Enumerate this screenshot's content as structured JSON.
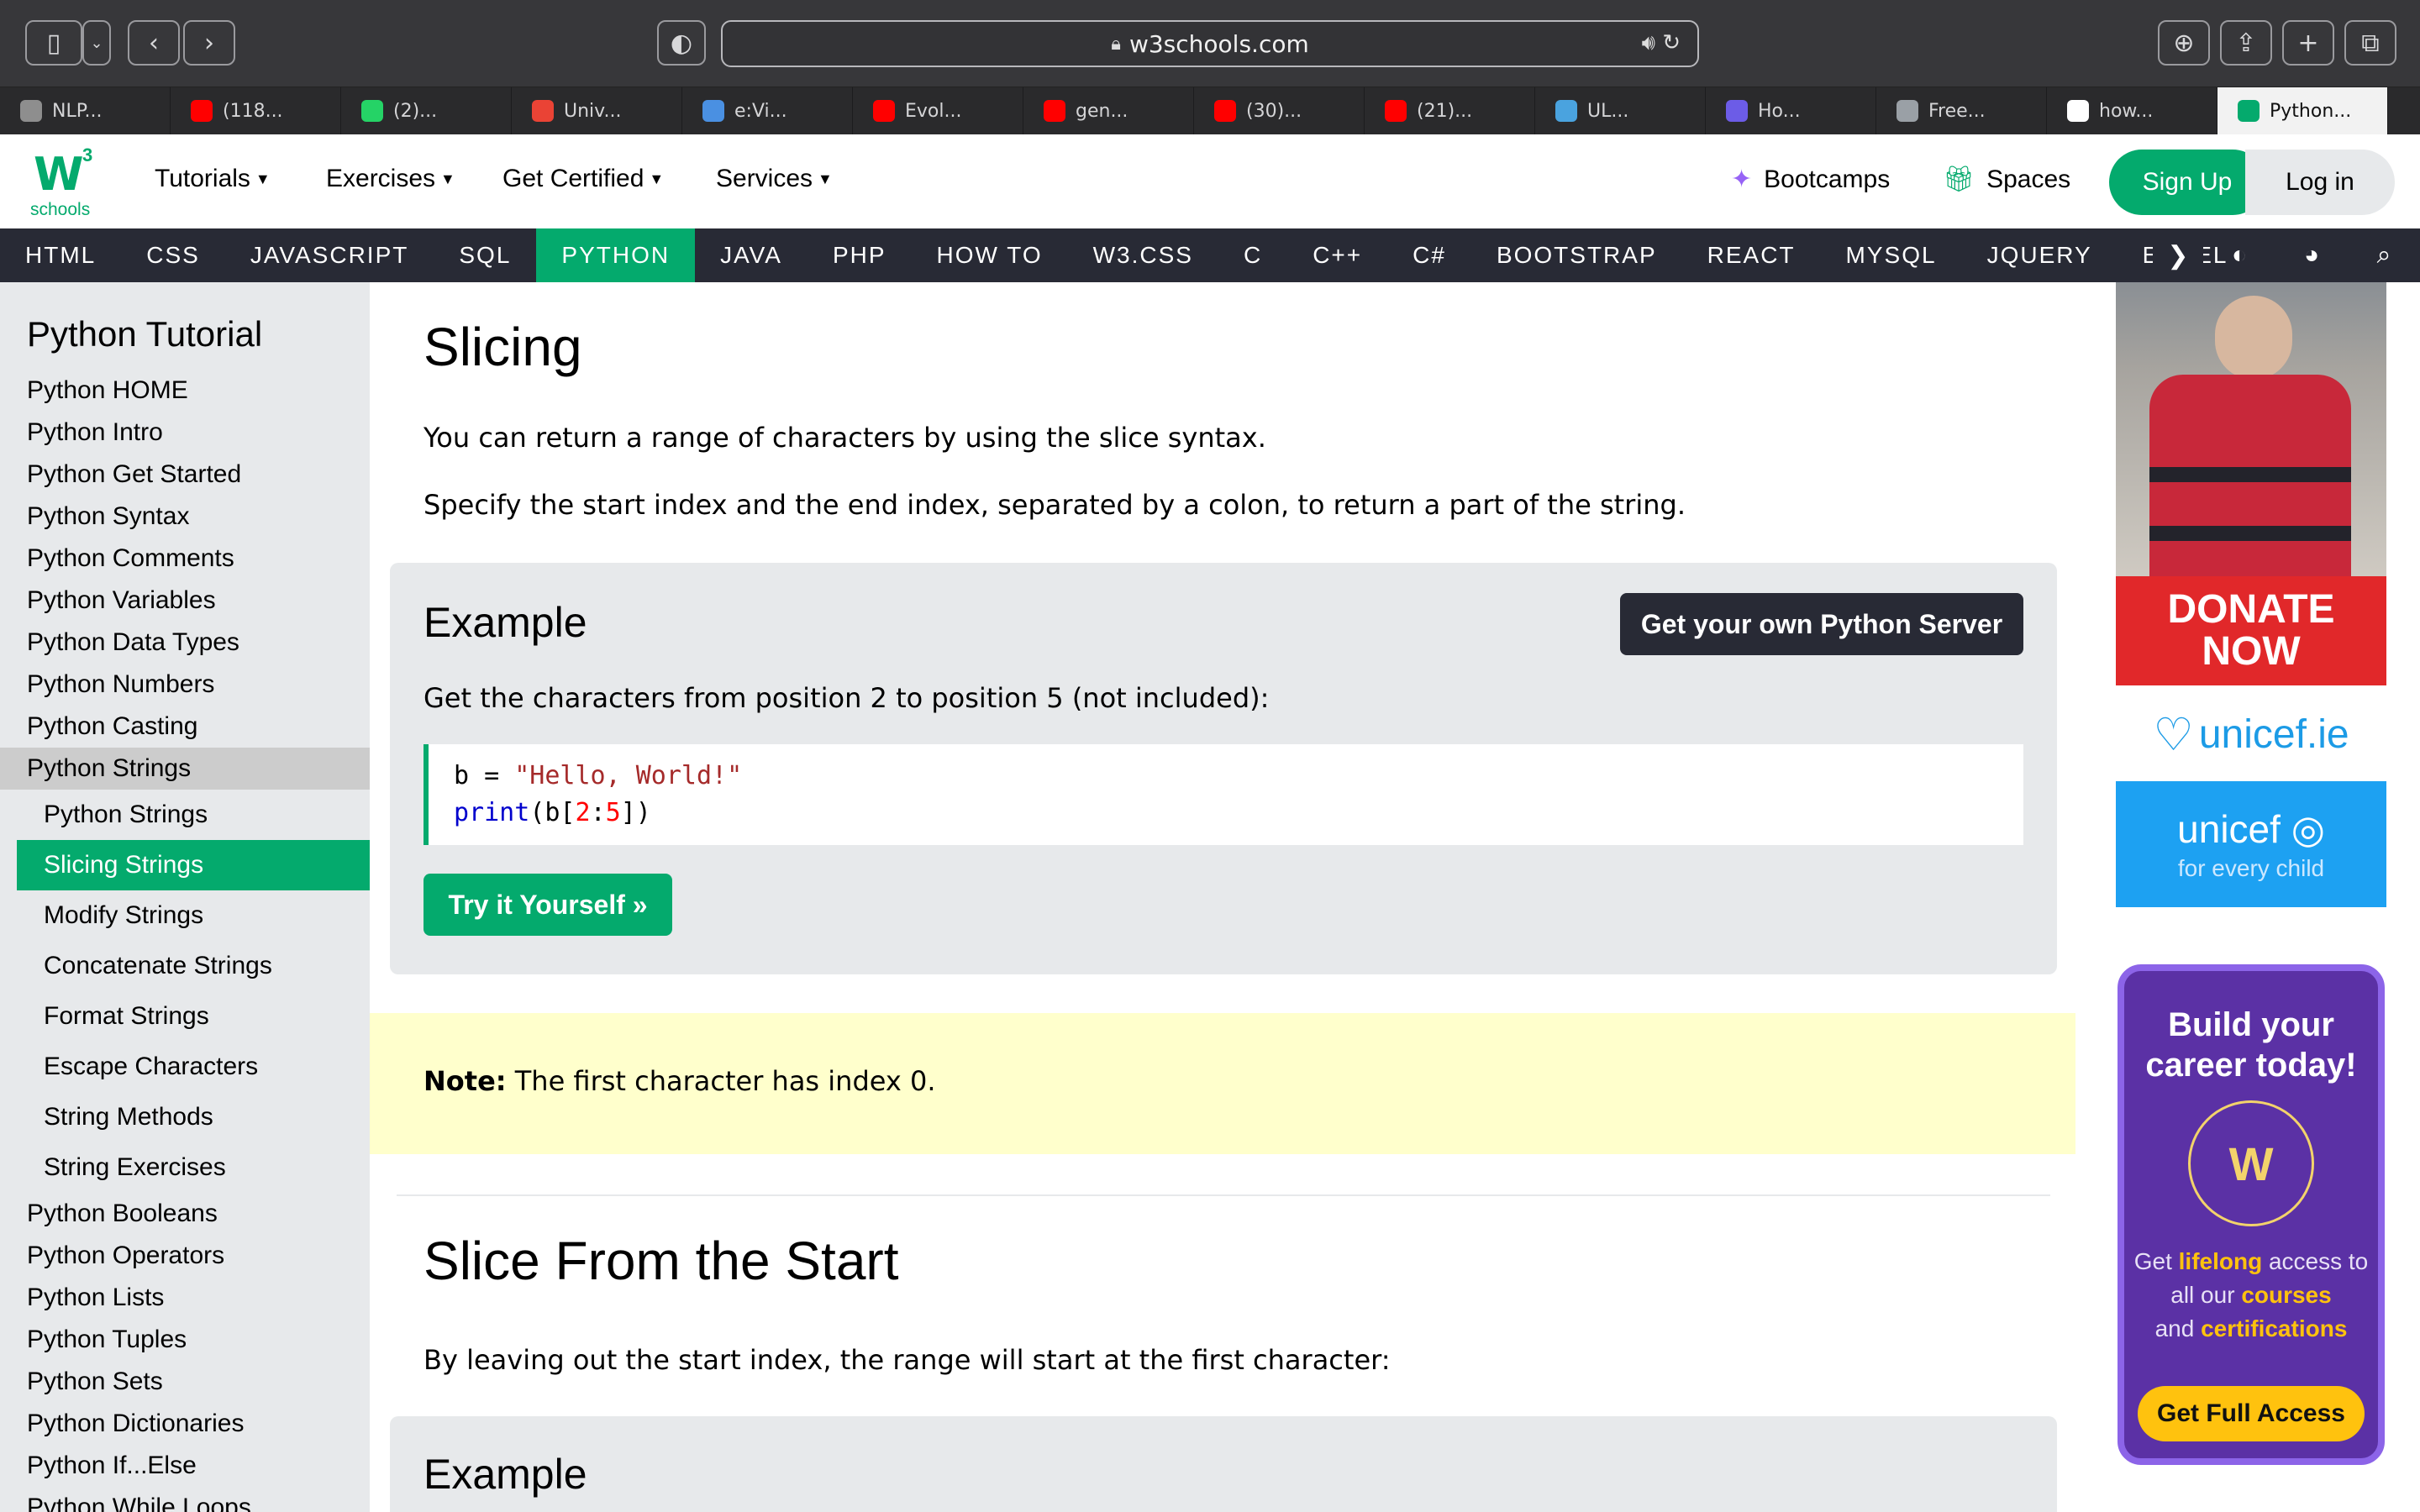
{
  "browser": {
    "url": "w3schools.com",
    "tabs": [
      "NLP...",
      "(118...",
      "(2)...",
      "Univ...",
      "e:Vi...",
      "Evol...",
      "gen...",
      "(30)...",
      "(21)...",
      "UL...",
      "Ho...",
      "Free...",
      "how...",
      "Python..."
    ],
    "tab_icons": [
      "chatgpt-icon",
      "youtube-icon",
      "whatsapp-icon",
      "gmail-icon",
      "drupal-icon",
      "youtube-icon",
      "youtube-icon",
      "youtube-icon",
      "youtube-icon",
      "doc-icon",
      "hex-icon",
      "quizlet-icon",
      "google-icon",
      "w3schools-icon"
    ],
    "tab_icon_colors": [
      "#8e8e8e",
      "#ff0000",
      "#25d366",
      "#ea4335",
      "#4a90e2",
      "#ff0000",
      "#ff0000",
      "#ff0000",
      "#ff0000",
      "#4aa3df",
      "#6c5ce7",
      "#9aa0a6",
      "#ffffff",
      "#04aa6d"
    ]
  },
  "header": {
    "logo_text": "schools",
    "logo_sup": "3",
    "nav": [
      "Tutorials",
      "Exercises",
      "Get Certified",
      "Services"
    ],
    "bootcamps": "Bootcamps",
    "spaces": "Spaces",
    "signup": "Sign Up",
    "login": "Log in",
    "accent": "#04aa6d"
  },
  "topics": [
    "HTML",
    "CSS",
    "JAVASCRIPT",
    "SQL",
    "PYTHON",
    "JAVA",
    "PHP",
    "HOW TO",
    "W3.CSS",
    "C",
    "C++",
    "C#",
    "BOOTSTRAP",
    "REACT",
    "MYSQL",
    "JQUERY",
    "EXCEL"
  ],
  "sidebar": {
    "title": "Python Tutorial",
    "items_before": [
      "Python HOME",
      "Python Intro",
      "Python Get Started",
      "Python Syntax",
      "Python Comments",
      "Python Variables",
      "Python Data Types",
      "Python Numbers",
      "Python Casting"
    ],
    "current": "Python Strings",
    "sub": [
      "Python Strings",
      "Slicing Strings",
      "Modify Strings",
      "Concatenate Strings",
      "Format Strings",
      "Escape Characters",
      "String Methods",
      "String Exercises"
    ],
    "items_after": [
      "Python Booleans",
      "Python Operators",
      "Python Lists",
      "Python Tuples",
      "Python Sets",
      "Python Dictionaries",
      "Python If...Else",
      "Python While Loops"
    ]
  },
  "main": {
    "heading": "Slicing",
    "p1": "You can return a range of characters by using the slice syntax.",
    "p2": "Specify the start index and the end index, separated by a colon, to return a part of the string.",
    "example_title": "Example",
    "server_btn": "Get your own Python Server",
    "example_desc": "Get the characters from position 2 to position 5 (not included):",
    "code_line1": {
      "a": "b = ",
      "s": "\"Hello, World!\""
    },
    "code_line2": {
      "fn": "print",
      "p1": "(b[",
      "n1": "2",
      "c": ":",
      "n2": "5",
      "p2": "])"
    },
    "try_btn": "Try it Yourself »",
    "note_label": "Note:",
    "note_text": " The first character has index 0.",
    "heading2": "Slice From the Start",
    "p3": "By leaving out the start index, the range will start at the first character:",
    "example2_title": "Example"
  },
  "ads": {
    "donate": "DONATE",
    "now": "NOW",
    "unicef_ie": "unicef.ie",
    "unicef": "unicef",
    "tagline": "for every child",
    "career_title1": "Build your",
    "career_title2": "career today!",
    "career_pre": "Get ",
    "career_b1": "lifelong",
    "career_mid": " access to all our ",
    "career_b2": "courses",
    "career_and": " and ",
    "career_b3": "certifications",
    "full_access": "Get Full Access"
  }
}
